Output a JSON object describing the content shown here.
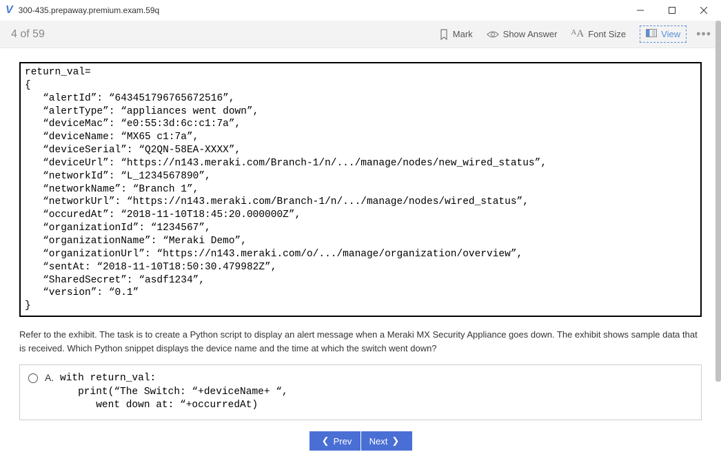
{
  "titleBar": {
    "title": "300-435.prepaway.premium.exam.59q"
  },
  "toolbar": {
    "progress": "4 of 59",
    "mark": "Mark",
    "showAnswer": "Show Answer",
    "fontSize": "Font Size",
    "view": "View"
  },
  "exhibit": "return_val=\n{\n   “alertId”: “643451796765672516”,\n   “alertType”: “appliances went down”,\n   “deviceMac”: “e0:55:3d:6c:c1:7a”,\n   “deviceName: “MX65 c1:7a”,\n   “deviceSerial”: “Q2QN-58EA-XXXX”,\n   “deviceUrl”: “https://n143.meraki.com/Branch-1/n/.../manage/nodes/new_wired_status”,\n   “networkId”: “L_1234567890”,\n   “networkName”: “Branch 1”,\n   “networkUrl”: “https://n143.meraki.com/Branch-1/n/.../manage/nodes/wired_status”,\n   “occuredAt”: “2018-11-10T18:45:20.000000Z”,\n   “organizationId”: “1234567”,\n   “organizationName”: “Meraki Demo”,\n   “organizationUrl”: “https://n143.meraki.com/o/.../manage/organization/overview”,\n   “sentAt: “2018-11-10T18:50:30.479982Z”,\n   “SharedSecret”: “asdf1234”,\n   “version”: “0.1”\n}",
  "question": "Refer to the exhibit. The task is to create a Python script to display an alert message when a Meraki MX Security Appliance goes down. The exhibit shows sample data that is received. Which Python snippet displays the device name and the time at which the switch went down?",
  "answer": {
    "label": "A.",
    "code": "with return_val:\n   print(“The Switch: “+deviceName+ “,\n      went down at: “+occurredAt)"
  },
  "nav": {
    "prev": "Prev",
    "next": "Next"
  }
}
